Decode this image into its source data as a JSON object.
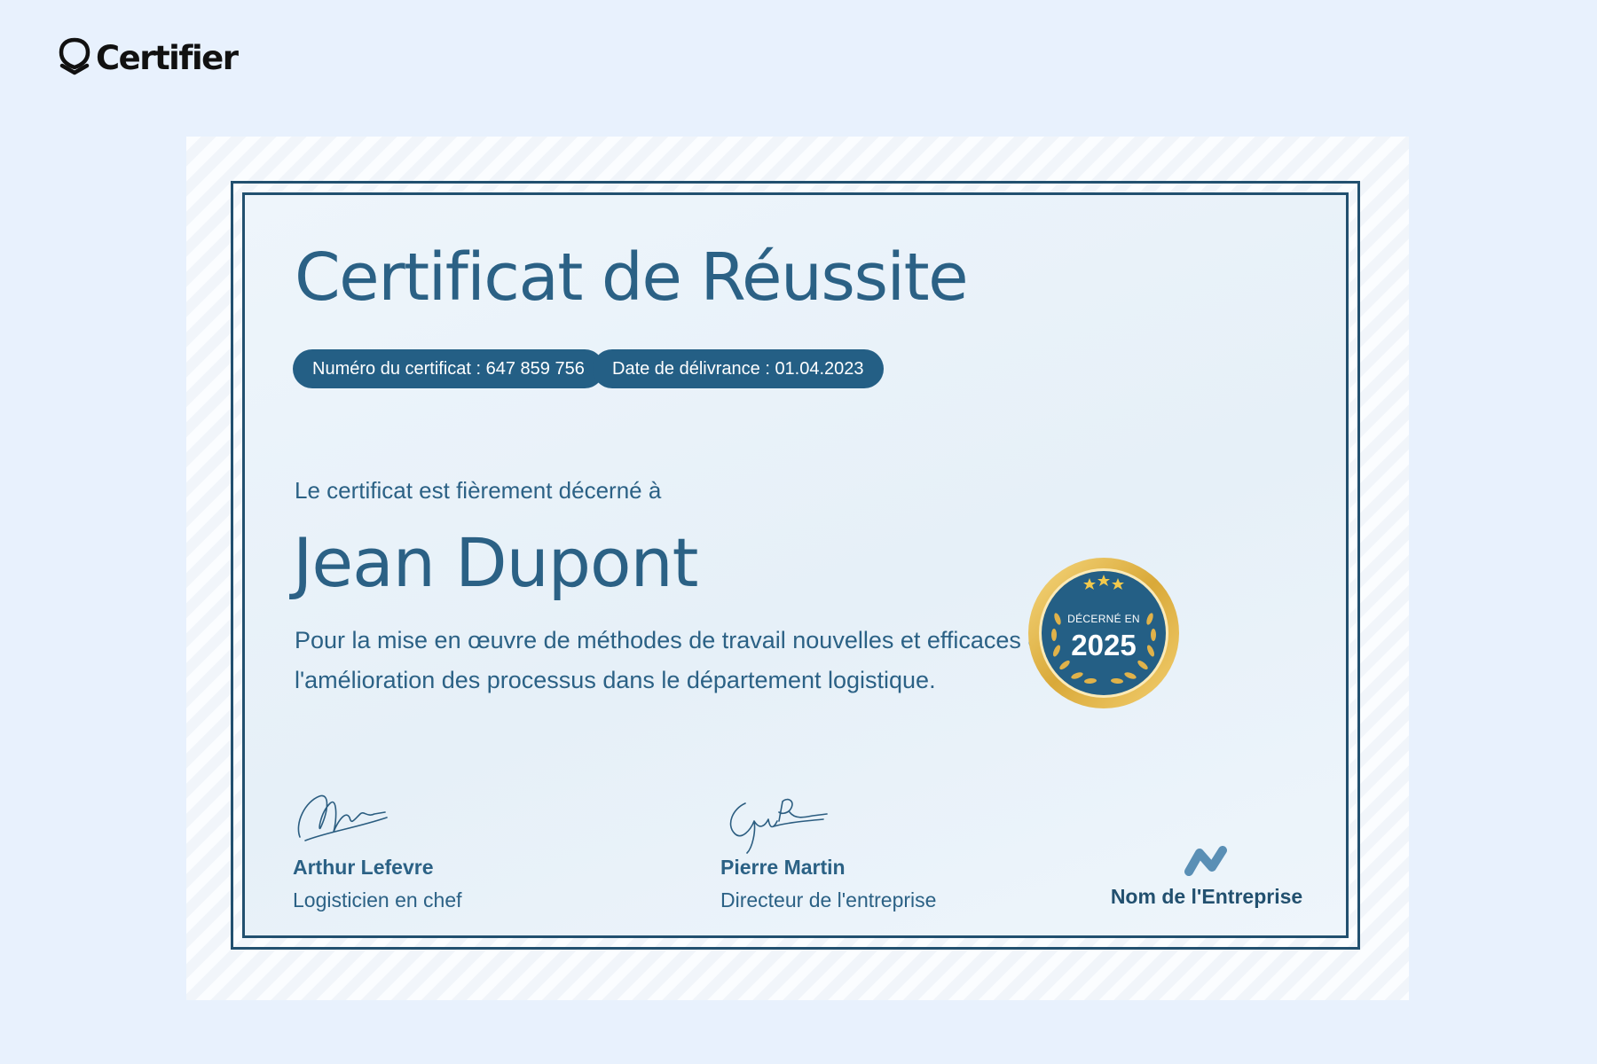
{
  "brand": {
    "name": "Certifier"
  },
  "certificate": {
    "title": "Certificat de Réussite",
    "number_pill": "Numéro du certificat : 647 859 756",
    "date_pill": "Date de délivrance : 01.04.2023",
    "intro": "Le certificat est fièrement décerné à",
    "recipient": "Jean Dupont",
    "description": "Pour la mise en œuvre de méthodes de travail nouvelles et efficaces et l'amélioration des processus dans le département logistique.",
    "seal": {
      "label": "DÉCERNÉ EN",
      "year": "2025"
    },
    "signers": [
      {
        "name": "Arthur Lefevre",
        "role": "Logisticien en chef"
      },
      {
        "name": "Pierre Martin",
        "role": "Directeur de l'entreprise"
      }
    ],
    "company": {
      "name": "Nom de l'Entreprise"
    }
  },
  "colors": {
    "page_background": "#e8f1fd",
    "primary_blue": "#2b6185",
    "frame_navy": "#22506f",
    "pill_blue": "#245f85",
    "seal_gold": "#d9a939",
    "logo_blue": "#5a8fb5"
  },
  "icons": {
    "brand": "shield-badge-icon",
    "seal": "award-medal-icon",
    "company": "company-n-logo-icon"
  }
}
